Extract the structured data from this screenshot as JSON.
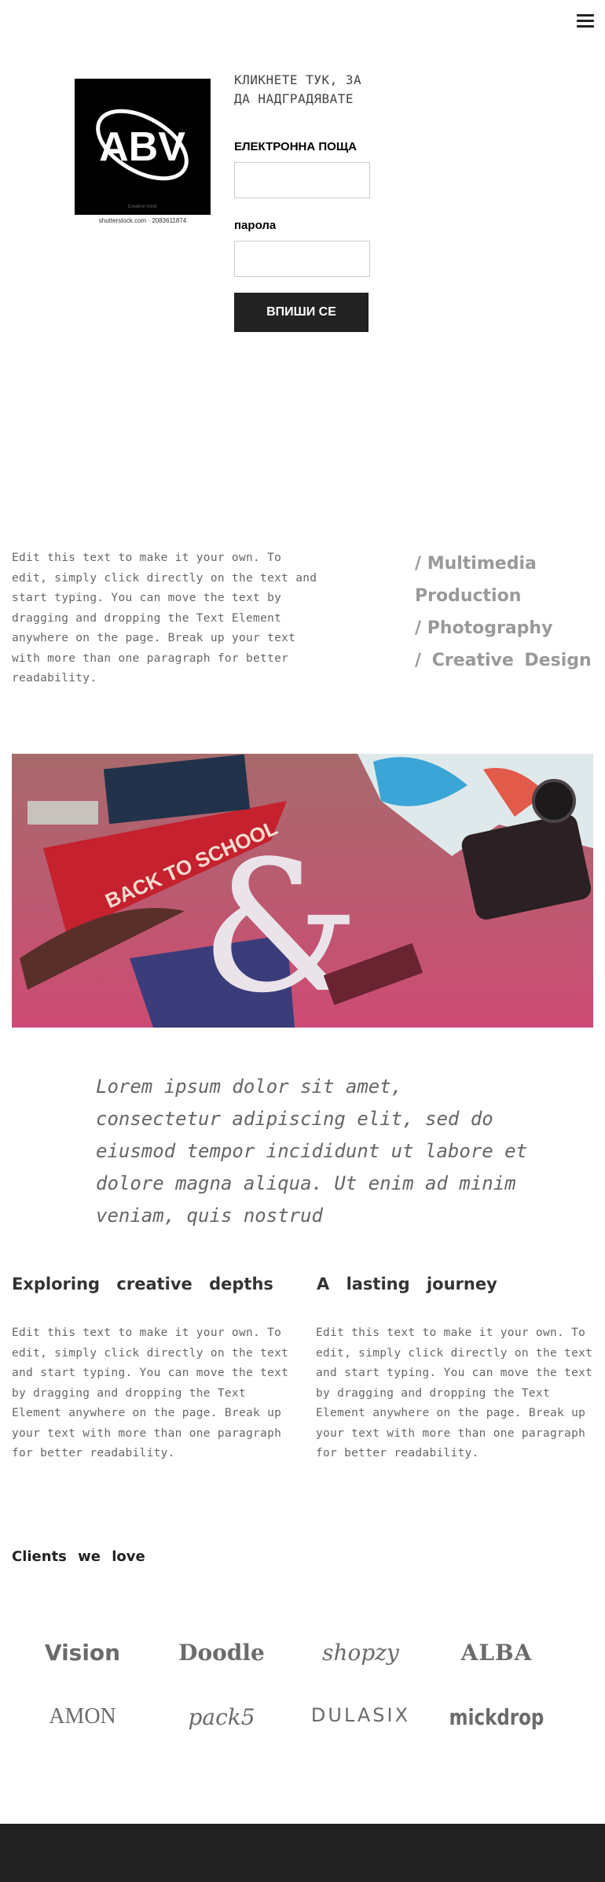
{
  "header": {
    "menu_icon": "hamburger-menu-icon"
  },
  "login": {
    "logo_text": "ABV",
    "logo_caption": "shutterstock.com · 2083611874",
    "upgrade_text": "КЛИКНЕТЕ ТУК, ЗА ДА НАДГРАДЯВАТЕ",
    "email_label": "ЕЛЕКТРОННА ПОЩА",
    "email_value": "",
    "password_label": "парола",
    "password_value": "",
    "submit_label": "ВПИШИ СЕ"
  },
  "intro": {
    "text": "Edit this text to make it your own. To edit, simply click directly on the text and start typing. You can move the text by dragging and dropping the Text Element anywhere on the page. Break up your text with more than one paragraph for better readability.",
    "services": [
      "/ Multimedia",
      "Production",
      "/ Photography",
      "/ Creative  Design"
    ]
  },
  "quote": {
    "text": "Lorem ipsum dolor sit amet, consectetur adipiscing elit, sed do eiusmod tempor incididunt ut labore et dolore magna aliqua. Ut enim ad minim veniam, quis nostrud"
  },
  "features": [
    {
      "title": "Exploring creative depths",
      "text": "Edit this text to make it your own. To edit, simply click directly on the text and start typing. You can move the text by dragging and dropping the Text Element anywhere on the page. Break up your text with more than one paragraph for better readability."
    },
    {
      "title": "A lasting journey",
      "text": "Edit this text to make it your own. To edit, simply click directly on the text and start typing. You can move the text by dragging and dropping the Text Element anywhere on the page. Break up your text with more than one paragraph for better readability."
    }
  ],
  "clients": {
    "title": "Clients we love",
    "logos": [
      "Vision",
      "Doodle",
      "shopzy",
      "ALBA",
      "AMON",
      "pack5",
      "DULASIX",
      "mickdrop"
    ]
  },
  "colors": {
    "button": "#222222",
    "footer": "#222222"
  }
}
